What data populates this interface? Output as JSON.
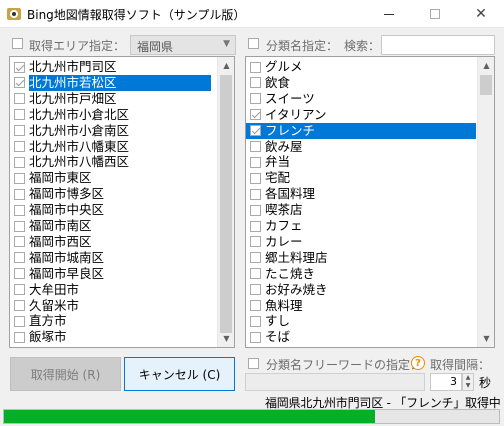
{
  "window": {
    "title": "Bing地図情報取得ソフト（サンプル版）"
  },
  "area": {
    "label": "取得エリア指定：",
    "checked": false,
    "prefecture": "福岡県"
  },
  "category": {
    "label": "分類名指定：",
    "checked": false,
    "search_label": "検索：",
    "search_value": ""
  },
  "area_list": [
    {
      "label": "北九州市門司区",
      "checked": true,
      "selected": false
    },
    {
      "label": "北九州市若松区",
      "checked": true,
      "selected": true
    },
    {
      "label": "北九州市戸畑区",
      "checked": false,
      "selected": false
    },
    {
      "label": "北九州市小倉北区",
      "checked": false,
      "selected": false
    },
    {
      "label": "北九州市小倉南区",
      "checked": false,
      "selected": false
    },
    {
      "label": "北九州市八幡東区",
      "checked": false,
      "selected": false
    },
    {
      "label": "北九州市八幡西区",
      "checked": false,
      "selected": false
    },
    {
      "label": "福岡市東区",
      "checked": false,
      "selected": false
    },
    {
      "label": "福岡市博多区",
      "checked": false,
      "selected": false
    },
    {
      "label": "福岡市中央区",
      "checked": false,
      "selected": false
    },
    {
      "label": "福岡市南区",
      "checked": false,
      "selected": false
    },
    {
      "label": "福岡市西区",
      "checked": false,
      "selected": false
    },
    {
      "label": "福岡市城南区",
      "checked": false,
      "selected": false
    },
    {
      "label": "福岡市早良区",
      "checked": false,
      "selected": false
    },
    {
      "label": "大牟田市",
      "checked": false,
      "selected": false
    },
    {
      "label": "久留米市",
      "checked": false,
      "selected": false
    },
    {
      "label": "直方市",
      "checked": false,
      "selected": false
    },
    {
      "label": "飯塚市",
      "checked": false,
      "selected": false
    }
  ],
  "category_list": [
    {
      "label": "グルメ",
      "checked": false,
      "selected": false
    },
    {
      "label": "飲食",
      "checked": false,
      "selected": false
    },
    {
      "label": "スイーツ",
      "checked": false,
      "selected": false
    },
    {
      "label": "イタリアン",
      "checked": true,
      "selected": false
    },
    {
      "label": "フレンチ",
      "checked": true,
      "selected": true
    },
    {
      "label": "飲み屋",
      "checked": false,
      "selected": false
    },
    {
      "label": "弁当",
      "checked": false,
      "selected": false
    },
    {
      "label": "宅配",
      "checked": false,
      "selected": false
    },
    {
      "label": "各国料理",
      "checked": false,
      "selected": false
    },
    {
      "label": "喫茶店",
      "checked": false,
      "selected": false
    },
    {
      "label": "カフェ",
      "checked": false,
      "selected": false
    },
    {
      "label": "カレー",
      "checked": false,
      "selected": false
    },
    {
      "label": "郷土料理店",
      "checked": false,
      "selected": false
    },
    {
      "label": "たこ焼き",
      "checked": false,
      "selected": false
    },
    {
      "label": "お好み焼き",
      "checked": false,
      "selected": false
    },
    {
      "label": "魚料理",
      "checked": false,
      "selected": false
    },
    {
      "label": "すし",
      "checked": false,
      "selected": false
    },
    {
      "label": "そば",
      "checked": false,
      "selected": false
    }
  ],
  "buttons": {
    "start_label": "取得開始 (R)",
    "cancel_label": "キャンセル (C)"
  },
  "freeword": {
    "label": "分類名フリーワードの指定：",
    "checked": false,
    "value": ""
  },
  "interval": {
    "label": "取得間隔：",
    "value": "3",
    "unit": "秒"
  },
  "status": {
    "text": "福岡県北九州市門司区 - 「フレンチ」取得中",
    "progress": 0.75
  },
  "icons": {
    "app": "app-logo-icon",
    "help": "help-icon",
    "help_glyph": "?"
  },
  "colors": {
    "selection": "#0078d7",
    "progress": "#06b025",
    "help": "#f08a00"
  }
}
